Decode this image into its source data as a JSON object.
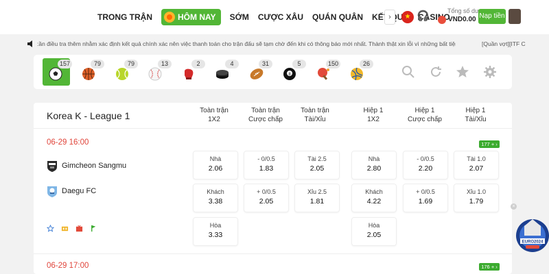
{
  "nav": {
    "items": [
      "TRONG TRẬN",
      "HÔM NAY",
      "SỚM",
      "CƯỢC XÂU",
      "QUÁN QUÂN",
      "KẾT QUẢ",
      "CASINO"
    ],
    "active_index": 1,
    "more_arrow": "›"
  },
  "account": {
    "balance_label": "Tổng số dư",
    "balance_value": "VND0.00",
    "deposit_label": "Nạp tiền"
  },
  "marquee": {
    "text": ":ần điều tra thêm nhằm xác định kết quả chính xác nên việc thanh toán cho trận đấu sẽ tạm chờ đến khi có thông báo mới nhất. Thành thật xin lỗi vì những bất tiện này!",
    "tag": "[Quần vợt][ITF C"
  },
  "sports": [
    {
      "name": "soccer",
      "count": "157",
      "color": "#222222"
    },
    {
      "name": "basketball",
      "count": "79",
      "color": "#e0612a"
    },
    {
      "name": "tennis",
      "count": "79",
      "color": "#b8d62a"
    },
    {
      "name": "baseball",
      "count": "13",
      "color": "#f1f1f1"
    },
    {
      "name": "boxing",
      "count": "2",
      "color": "#d42a2a"
    },
    {
      "name": "ice-hockey",
      "count": "4",
      "color": "#222222"
    },
    {
      "name": "american-football",
      "count": "31",
      "color": "#c8792a"
    },
    {
      "name": "billiards",
      "count": "5",
      "color": "#111111"
    },
    {
      "name": "table-tennis",
      "count": "150",
      "color": "#e24a3a"
    },
    {
      "name": "volleyball",
      "count": "26",
      "color": "#f2b829"
    }
  ],
  "league": {
    "name": "Korea K - League 1",
    "columns": [
      [
        "Toàn trận",
        "1X2"
      ],
      [
        "Toàn trận",
        "Cược chấp"
      ],
      [
        "Toàn trận",
        "Tài/Xỉu"
      ],
      [
        "Hiệp 1",
        "1X2"
      ],
      [
        "Hiệp 1",
        "Cược chấp"
      ],
      [
        "Hiệp 1",
        "Tài/Xỉu"
      ]
    ]
  },
  "match1": {
    "time": "06-29 16:00",
    "more": "177 + ›",
    "home": "Gimcheon Sangmu",
    "away": "Daegu FC",
    "odds": [
      [
        {
          "l": "Nhà",
          "v": "2.06"
        },
        {
          "l": "- 0/0.5",
          "v": "1.83"
        },
        {
          "l": "Tài 2.5",
          "v": "2.05"
        },
        {
          "l": "Nhà",
          "v": "2.80"
        },
        {
          "l": "- 0/0.5",
          "v": "2.20"
        },
        {
          "l": "Tài 1.0",
          "v": "2.07"
        }
      ],
      [
        {
          "l": "Khách",
          "v": "3.38"
        },
        {
          "l": "+ 0/0.5",
          "v": "2.05"
        },
        {
          "l": "Xỉu 2.5",
          "v": "1.81"
        },
        {
          "l": "Khách",
          "v": "4.22"
        },
        {
          "l": "+ 0/0.5",
          "v": "1.69"
        },
        {
          "l": "Xỉu 1.0",
          "v": "1.79"
        }
      ]
    ],
    "draw_ft": {
      "l": "Hòa",
      "v": "3.33"
    },
    "draw_ht": {
      "l": "Hòa",
      "v": "2.05"
    }
  },
  "match2": {
    "time": "06-29 17:00",
    "more": "176 + ›"
  },
  "promo": {
    "text": "EURO2024"
  }
}
